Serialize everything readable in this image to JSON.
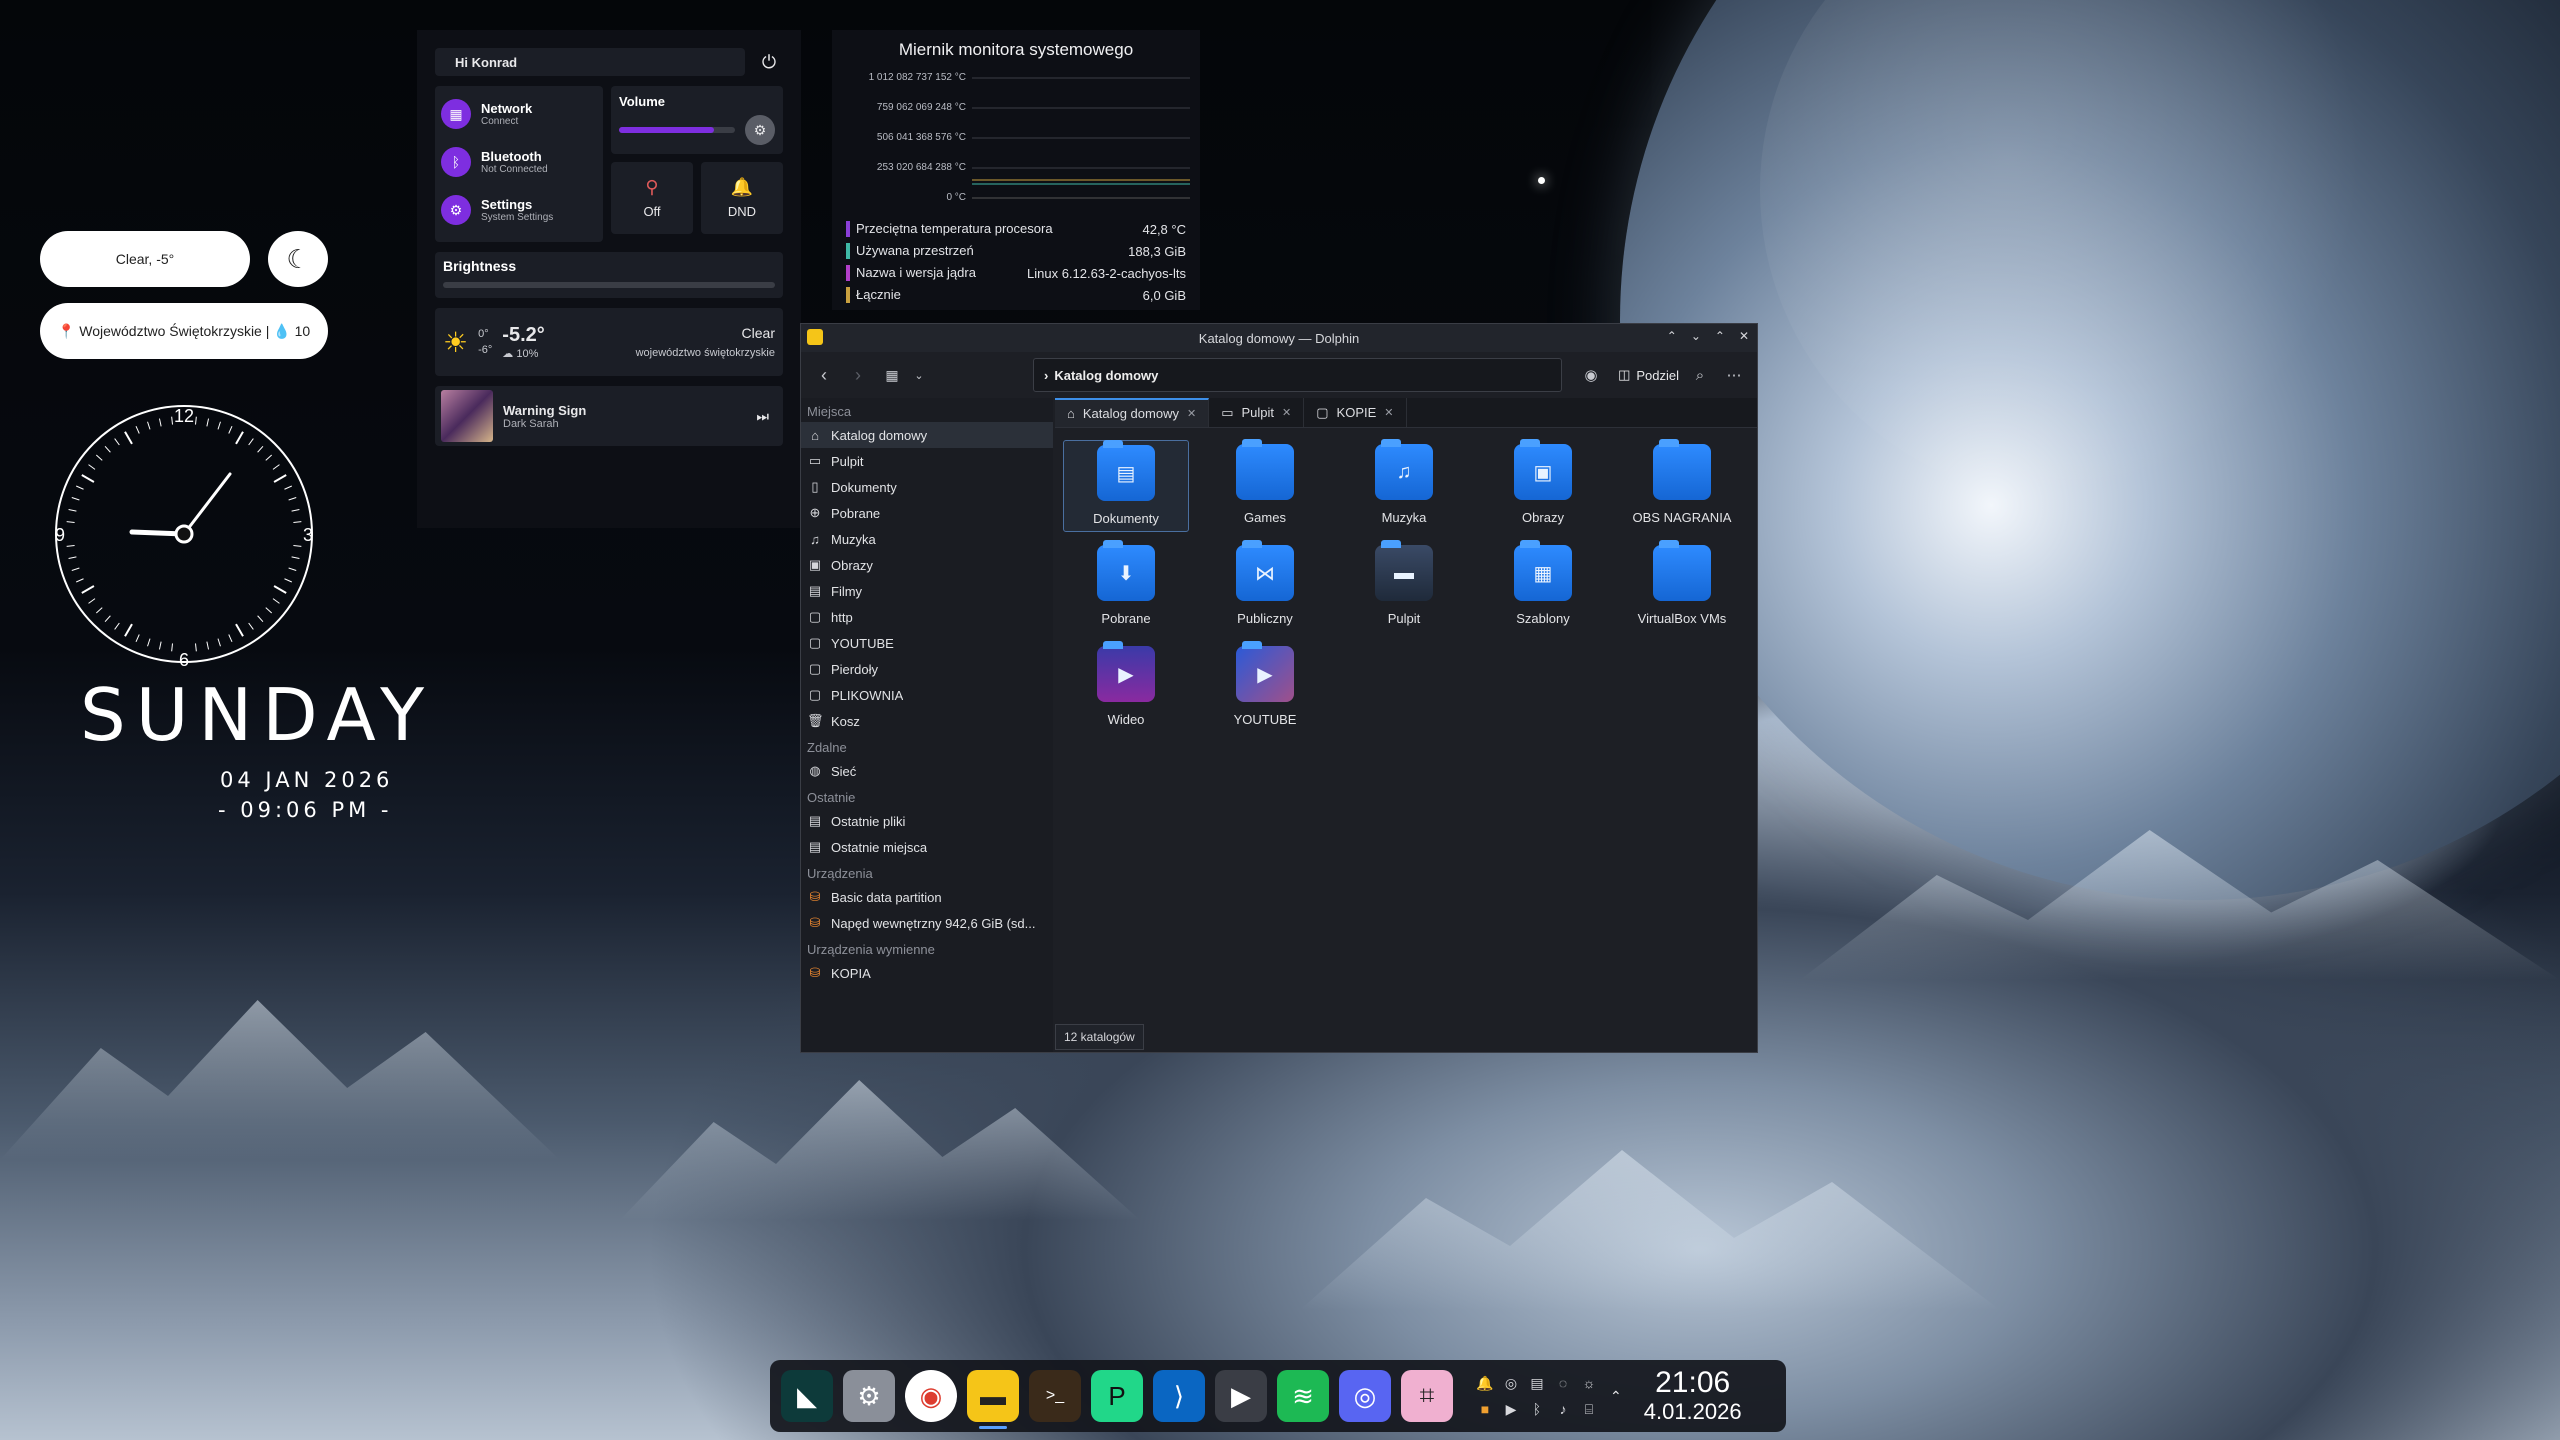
{
  "weather": {
    "condition_pill": "Clear, -5°",
    "location_pill": "Województwo Świętokrzyskie | 💧 10"
  },
  "clock": {
    "n12": "12",
    "n3": "3",
    "n6": "6",
    "n9": "9",
    "day": "SUNDAY",
    "date": "04 JAN 2026",
    "time": "- 09:06 PM -"
  },
  "quick": {
    "greeting": "Hi Konrad",
    "network_title": "Network",
    "network_sub": "Connect",
    "bluetooth_title": "Bluetooth",
    "bluetooth_sub": "Not Connected",
    "settings_title": "Settings",
    "settings_sub": "System Settings",
    "volume_label": "Volume",
    "volume_level": 0.82,
    "off_label": "Off",
    "dnd_label": "DND",
    "brightness_label": "Brightness",
    "brightness_level": 0.0,
    "temp_hi": "0°",
    "temp_lo": "-6°",
    "temp_now": "-5.2°",
    "precip": "10%",
    "cond": "Clear",
    "region": "województwo świętokrzyskie",
    "track_title": "Warning Sign",
    "track_artist": "Dark Sarah"
  },
  "monitor": {
    "title": "Miernik monitora systemowego",
    "ticks": [
      "1 012 082 737 152 °C",
      "759 062 069 248 °C",
      "506 041 368 576 °C",
      "253 020 684 288 °C",
      "0 °C"
    ],
    "rows": [
      {
        "label": "Przeciętna temperatura procesora",
        "value": "42,8 °C",
        "color": "#8a3fd8"
      },
      {
        "label": "Używana przestrzeń",
        "value": "188,3 GiB",
        "color": "#3fb8a6"
      },
      {
        "label": "Nazwa i wersja jądra",
        "value": "Linux 6.12.63-2-cachyos-lts",
        "color": "#b23fc9"
      },
      {
        "label": "Łącznie",
        "value": "6,0 GiB",
        "color": "#c9a03f"
      }
    ]
  },
  "dolphin": {
    "title": "Katalog domowy — Dolphin",
    "address": "Katalog domowy",
    "split_label": "Podziel",
    "tabs": [
      "Katalog domowy",
      "Pulpit",
      "KOPIE"
    ],
    "sections": {
      "places": "Miejsca",
      "remote": "Zdalne",
      "recent": "Ostatnie",
      "devices": "Urządzenia",
      "removable": "Urządzenia wymienne"
    },
    "places": [
      "Katalog domowy",
      "Pulpit",
      "Dokumenty",
      "Pobrane",
      "Muzyka",
      "Obrazy",
      "Filmy",
      "http",
      "YOUTUBE",
      "Pierdoły",
      "PLIKOWNIA",
      "Kosz"
    ],
    "remote": [
      "Sieć"
    ],
    "recent": [
      "Ostatnie pliki",
      "Ostatnie miejsca"
    ],
    "devices": [
      "Basic data partition",
      "Napęd wewnętrzny 942,6 GiB (sd..."
    ],
    "removable": [
      "KOPIA"
    ],
    "files": [
      "Dokumenty",
      "Games",
      "Muzyka",
      "Obrazy",
      "OBS NAGRANIA",
      "Pobrane",
      "Publiczny",
      "Pulpit",
      "Szablony",
      "VirtualBox VMs",
      "Wideo",
      "YOUTUBE"
    ],
    "status": "12 katalogów"
  },
  "taskbar": {
    "time": "21:06",
    "date": "4.01.2026",
    "apps": [
      "cachyos-hello-icon",
      "settings-icon",
      "chrome-icon",
      "files-icon",
      "terminal-icon",
      "pycharm-icon",
      "vscode-icon",
      "video-icon",
      "spotify-icon",
      "discord-icon",
      "screenshot-icon"
    ]
  }
}
